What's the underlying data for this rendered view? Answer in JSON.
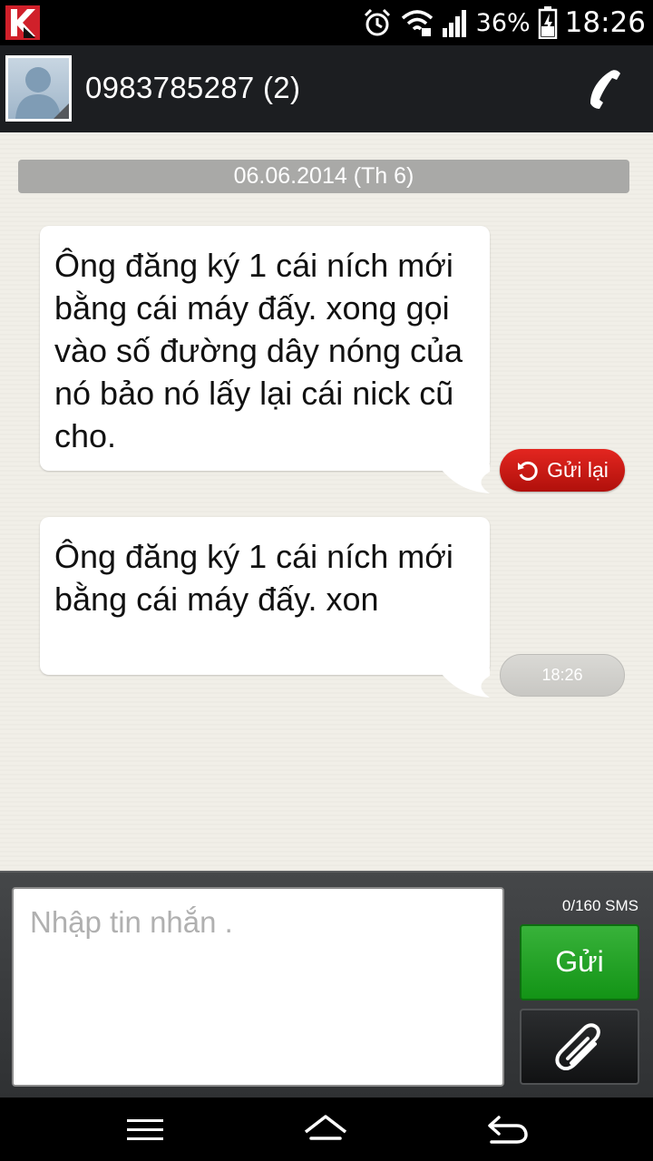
{
  "status_bar": {
    "app_icon": "kaspersky-icon",
    "icons": [
      "alarm-icon",
      "wifi-icon",
      "signal-icon",
      "battery-charging-icon"
    ],
    "battery": "36%",
    "time": "18:26"
  },
  "header": {
    "title": "0983785287 (2)",
    "avatar_icon": "contact-avatar-icon",
    "call_icon": "phone-icon"
  },
  "conversation": {
    "date": "06.06.2014 (Th 6)",
    "messages": [
      {
        "text": "Ông đăng ký 1 cái ních mới bằng cái máy đấy. xong gọi vào số đường dây nóng của nó bảo nó lấy lại cái nick cũ cho.",
        "status_label": "Gửi lại",
        "status_icon": "retry-icon"
      },
      {
        "text": "Ông đăng ký 1 cái ních mới bằng cái máy đấy. xon",
        "time": "18:26"
      }
    ]
  },
  "compose": {
    "placeholder": "Nhập tin nhắn .",
    "counter": "0/160 SMS",
    "send_label": "Gửi",
    "attach_icon": "paperclip-icon"
  },
  "nav_bar": {
    "icons": [
      "menu-icon",
      "home-icon",
      "back-icon"
    ]
  },
  "colors": {
    "send_green": "#139416",
    "resend_red": "#c8151b",
    "conversation_bg": "#f1efe8"
  }
}
